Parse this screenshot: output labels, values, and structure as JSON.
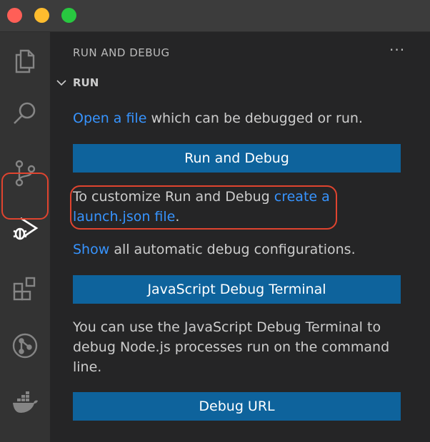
{
  "window": {
    "controls": [
      "close",
      "minimize",
      "maximize"
    ]
  },
  "activity_bar": {
    "items": [
      {
        "icon": "explorer-icon"
      },
      {
        "icon": "search-icon"
      },
      {
        "icon": "source-control-icon"
      },
      {
        "icon": "run-debug-icon",
        "active": true
      },
      {
        "icon": "extensions-icon"
      },
      {
        "icon": "git-graph-icon"
      },
      {
        "icon": "docker-icon"
      }
    ]
  },
  "sidebar": {
    "title": "RUN AND DEBUG",
    "more": "···",
    "section": {
      "label": "RUN",
      "open_file_link": "Open a file",
      "open_file_text": " which can be debugged or run.",
      "run_debug_button": "Run and Debug",
      "customize_prefix": "To customize Run and Debug ",
      "customize_link_1": "create a",
      "customize_link_2": "launch.json file",
      "customize_suffix": ".",
      "show_link": "Show",
      "show_text": " all automatic debug configurations.",
      "js_debug_button": "JavaScript Debug Terminal",
      "js_debug_desc": "You can use the JavaScript Debug Terminal to debug Node.js processes run on the command line.",
      "debug_url_button": "Debug URL"
    }
  },
  "colors": {
    "accent_button": "#0e639c",
    "link": "#3794ff",
    "annotation": "#e0442f"
  }
}
